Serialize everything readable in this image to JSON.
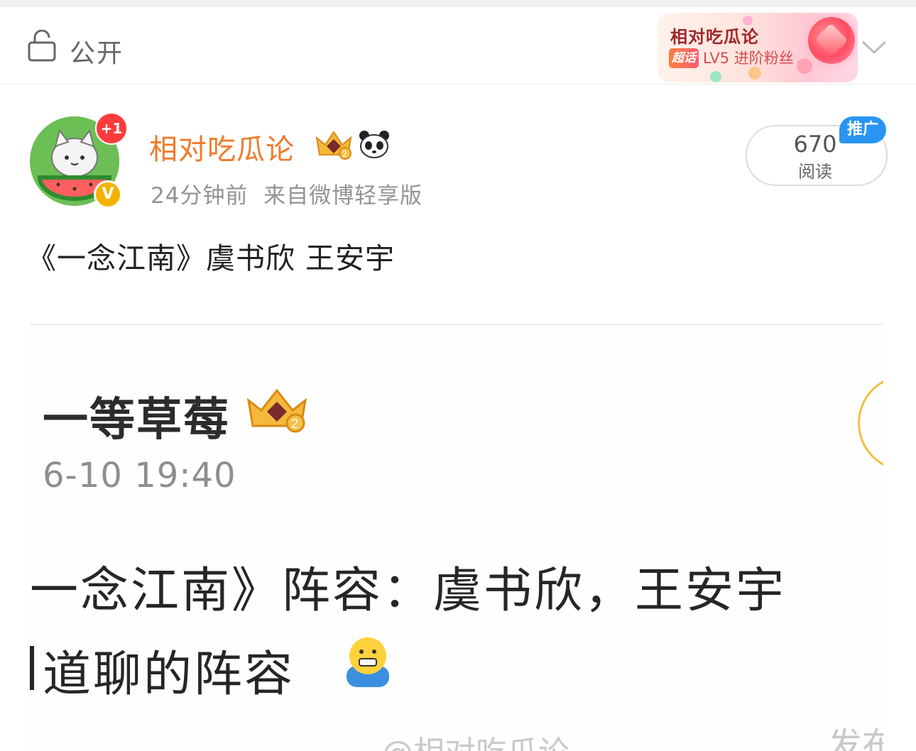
{
  "header": {
    "visibility_label": "公开",
    "badge": {
      "name": "相对吃瓜论",
      "tag": "超话",
      "level": "LV5 进阶粉丝"
    }
  },
  "post": {
    "author": "相对吃瓜论",
    "notify_count": "+1",
    "verified_mark": "V",
    "time": "24分钟前",
    "source": "来自微博轻享版",
    "read_count": "670",
    "read_label": "阅读",
    "promo_tag": "推广",
    "text": "《一念江南》虞书欣 王安宇"
  },
  "quoted_image": {
    "user": "一等草莓",
    "time": "6-10 19:40",
    "line1": "一念江南》阵容：虞书欣，王安宇",
    "line2": "道聊的阵容",
    "watermark": "@相对吃瓜论",
    "watermark_right": "发布"
  },
  "colors": {
    "author_name": "#f07a2a",
    "promo": "#2a94f3",
    "verified": "#f5b300",
    "notify": "#ff3b3b"
  }
}
